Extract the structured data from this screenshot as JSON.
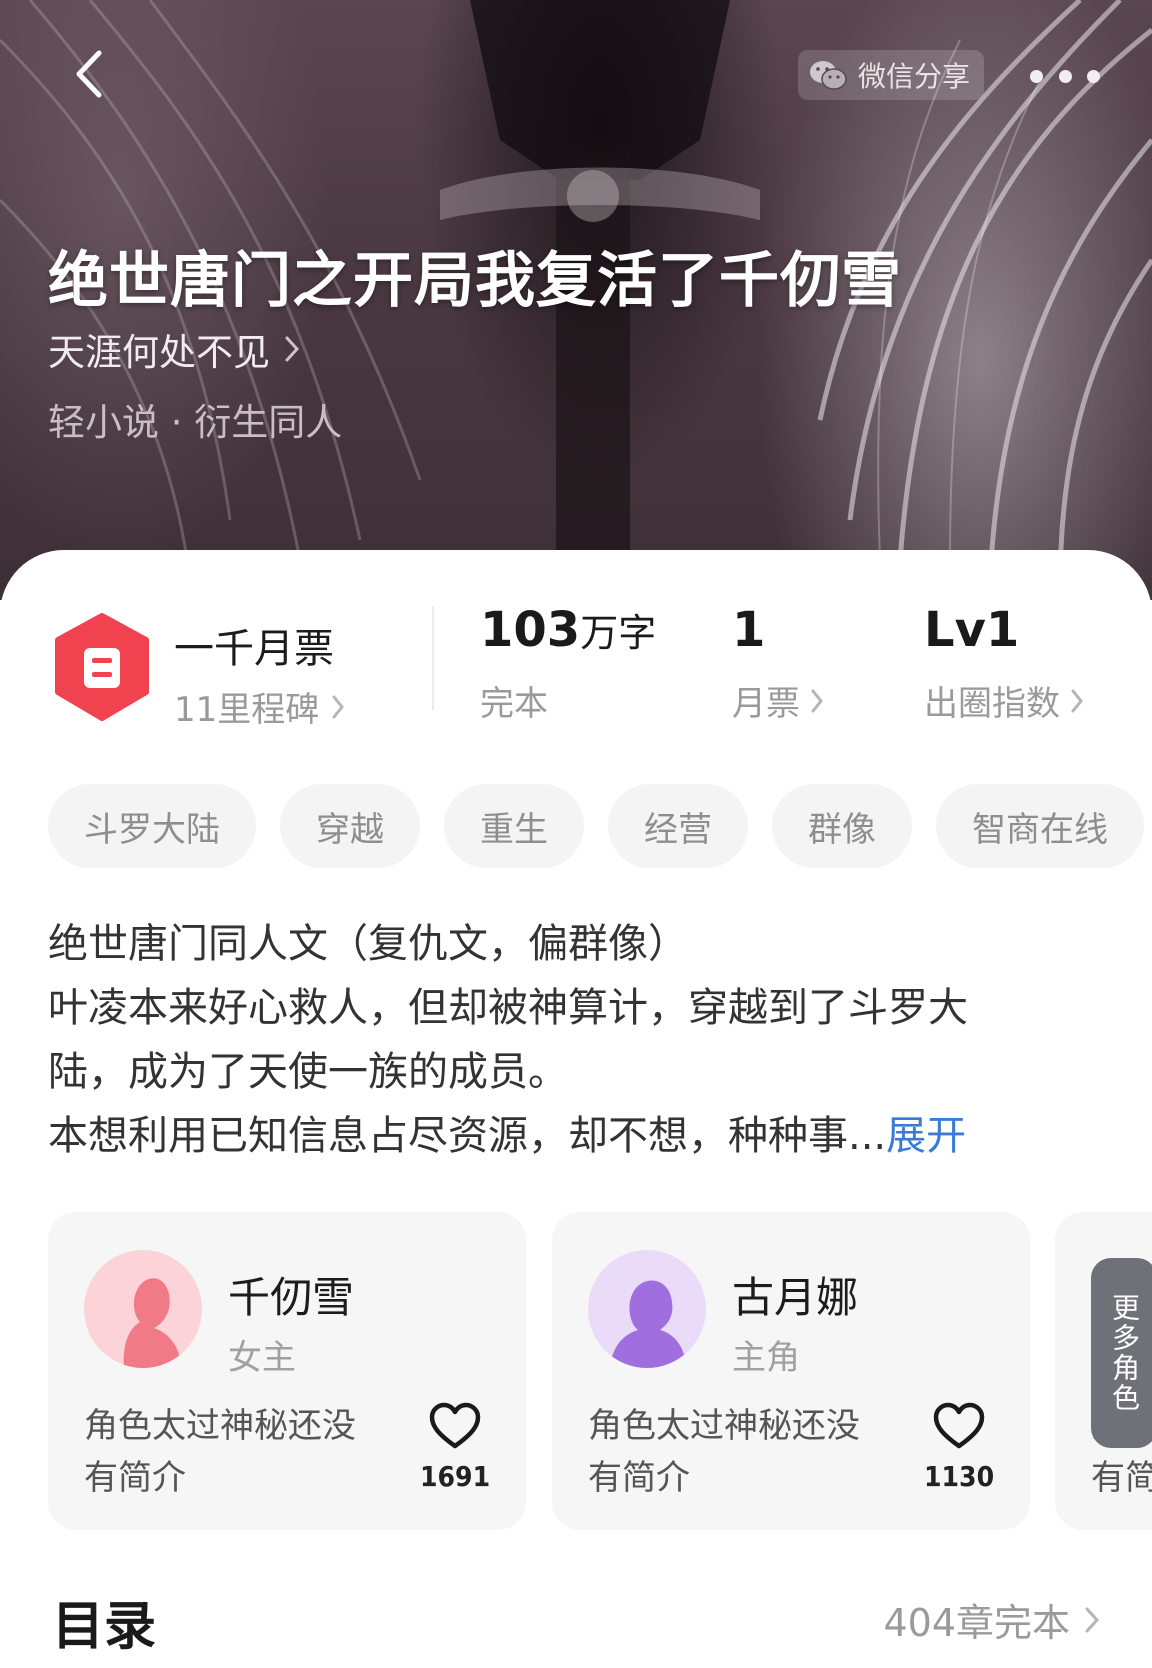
{
  "header": {
    "share_label": "微信分享",
    "icons": [
      "back-arrow-icon",
      "wechat-icon",
      "more-icon"
    ]
  },
  "book": {
    "title": "绝世唐门之开局我复活了千仞雪",
    "author": "天涯何处不见",
    "genre": "轻小说 · 衍生同人"
  },
  "stats": {
    "milestone_title": "一千月票",
    "milestone_sub": "11里程碑",
    "words_value": "103",
    "words_unit": "万字",
    "words_label": "完本",
    "monthly_value": "1",
    "monthly_label": "月票",
    "index_value": "Lv1",
    "index_label": "出圈指数"
  },
  "tags": [
    "斗罗大陆",
    "穿越",
    "重生",
    "经营",
    "群像",
    "智商在线"
  ],
  "description": {
    "lines": [
      "绝世唐门同人文（复仇文，偏群像）",
      "叶凌本来好心救人，但却被神算计，穿越到了斗罗大",
      "陆，成为了天使一族的成员。",
      "本想利用已知信息占尽资源，却不想，种种事..."
    ],
    "expand_label": "展开"
  },
  "characters": [
    {
      "name": "千仞雪",
      "role": "女主",
      "intro": "角色太过神秘还没有简介",
      "likes": "1691",
      "avatar_color": "#f07a86"
    },
    {
      "name": "古月娜",
      "role": "主角",
      "intro": "角色太过神秘还没有简介",
      "likes": "1130",
      "avatar_color": "#a16ee0"
    }
  ],
  "more_characters": {
    "label": "更多角色",
    "intro_partial": "角色\n有简"
  },
  "toc": {
    "title": "目录",
    "count": "404章完本"
  },
  "colors": {
    "accent_blue": "#3a7bd5",
    "ticket_red": "#f0434f"
  }
}
